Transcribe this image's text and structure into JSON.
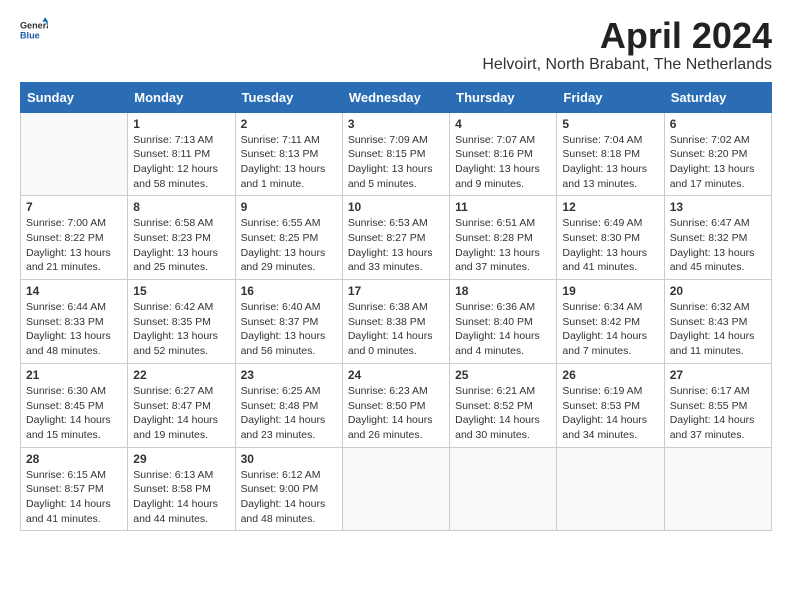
{
  "header": {
    "logo_general": "General",
    "logo_blue": "Blue",
    "month_title": "April 2024",
    "location": "Helvoirt, North Brabant, The Netherlands"
  },
  "days_of_week": [
    "Sunday",
    "Monday",
    "Tuesday",
    "Wednesday",
    "Thursday",
    "Friday",
    "Saturday"
  ],
  "weeks": [
    [
      {
        "day": "",
        "sunrise": "",
        "sunset": "",
        "daylight": ""
      },
      {
        "day": "1",
        "sunrise": "Sunrise: 7:13 AM",
        "sunset": "Sunset: 8:11 PM",
        "daylight": "Daylight: 12 hours and 58 minutes."
      },
      {
        "day": "2",
        "sunrise": "Sunrise: 7:11 AM",
        "sunset": "Sunset: 8:13 PM",
        "daylight": "Daylight: 13 hours and 1 minute."
      },
      {
        "day": "3",
        "sunrise": "Sunrise: 7:09 AM",
        "sunset": "Sunset: 8:15 PM",
        "daylight": "Daylight: 13 hours and 5 minutes."
      },
      {
        "day": "4",
        "sunrise": "Sunrise: 7:07 AM",
        "sunset": "Sunset: 8:16 PM",
        "daylight": "Daylight: 13 hours and 9 minutes."
      },
      {
        "day": "5",
        "sunrise": "Sunrise: 7:04 AM",
        "sunset": "Sunset: 8:18 PM",
        "daylight": "Daylight: 13 hours and 13 minutes."
      },
      {
        "day": "6",
        "sunrise": "Sunrise: 7:02 AM",
        "sunset": "Sunset: 8:20 PM",
        "daylight": "Daylight: 13 hours and 17 minutes."
      }
    ],
    [
      {
        "day": "7",
        "sunrise": "Sunrise: 7:00 AM",
        "sunset": "Sunset: 8:22 PM",
        "daylight": "Daylight: 13 hours and 21 minutes."
      },
      {
        "day": "8",
        "sunrise": "Sunrise: 6:58 AM",
        "sunset": "Sunset: 8:23 PM",
        "daylight": "Daylight: 13 hours and 25 minutes."
      },
      {
        "day": "9",
        "sunrise": "Sunrise: 6:55 AM",
        "sunset": "Sunset: 8:25 PM",
        "daylight": "Daylight: 13 hours and 29 minutes."
      },
      {
        "day": "10",
        "sunrise": "Sunrise: 6:53 AM",
        "sunset": "Sunset: 8:27 PM",
        "daylight": "Daylight: 13 hours and 33 minutes."
      },
      {
        "day": "11",
        "sunrise": "Sunrise: 6:51 AM",
        "sunset": "Sunset: 8:28 PM",
        "daylight": "Daylight: 13 hours and 37 minutes."
      },
      {
        "day": "12",
        "sunrise": "Sunrise: 6:49 AM",
        "sunset": "Sunset: 8:30 PM",
        "daylight": "Daylight: 13 hours and 41 minutes."
      },
      {
        "day": "13",
        "sunrise": "Sunrise: 6:47 AM",
        "sunset": "Sunset: 8:32 PM",
        "daylight": "Daylight: 13 hours and 45 minutes."
      }
    ],
    [
      {
        "day": "14",
        "sunrise": "Sunrise: 6:44 AM",
        "sunset": "Sunset: 8:33 PM",
        "daylight": "Daylight: 13 hours and 48 minutes."
      },
      {
        "day": "15",
        "sunrise": "Sunrise: 6:42 AM",
        "sunset": "Sunset: 8:35 PM",
        "daylight": "Daylight: 13 hours and 52 minutes."
      },
      {
        "day": "16",
        "sunrise": "Sunrise: 6:40 AM",
        "sunset": "Sunset: 8:37 PM",
        "daylight": "Daylight: 13 hours and 56 minutes."
      },
      {
        "day": "17",
        "sunrise": "Sunrise: 6:38 AM",
        "sunset": "Sunset: 8:38 PM",
        "daylight": "Daylight: 14 hours and 0 minutes."
      },
      {
        "day": "18",
        "sunrise": "Sunrise: 6:36 AM",
        "sunset": "Sunset: 8:40 PM",
        "daylight": "Daylight: 14 hours and 4 minutes."
      },
      {
        "day": "19",
        "sunrise": "Sunrise: 6:34 AM",
        "sunset": "Sunset: 8:42 PM",
        "daylight": "Daylight: 14 hours and 7 minutes."
      },
      {
        "day": "20",
        "sunrise": "Sunrise: 6:32 AM",
        "sunset": "Sunset: 8:43 PM",
        "daylight": "Daylight: 14 hours and 11 minutes."
      }
    ],
    [
      {
        "day": "21",
        "sunrise": "Sunrise: 6:30 AM",
        "sunset": "Sunset: 8:45 PM",
        "daylight": "Daylight: 14 hours and 15 minutes."
      },
      {
        "day": "22",
        "sunrise": "Sunrise: 6:27 AM",
        "sunset": "Sunset: 8:47 PM",
        "daylight": "Daylight: 14 hours and 19 minutes."
      },
      {
        "day": "23",
        "sunrise": "Sunrise: 6:25 AM",
        "sunset": "Sunset: 8:48 PM",
        "daylight": "Daylight: 14 hours and 23 minutes."
      },
      {
        "day": "24",
        "sunrise": "Sunrise: 6:23 AM",
        "sunset": "Sunset: 8:50 PM",
        "daylight": "Daylight: 14 hours and 26 minutes."
      },
      {
        "day": "25",
        "sunrise": "Sunrise: 6:21 AM",
        "sunset": "Sunset: 8:52 PM",
        "daylight": "Daylight: 14 hours and 30 minutes."
      },
      {
        "day": "26",
        "sunrise": "Sunrise: 6:19 AM",
        "sunset": "Sunset: 8:53 PM",
        "daylight": "Daylight: 14 hours and 34 minutes."
      },
      {
        "day": "27",
        "sunrise": "Sunrise: 6:17 AM",
        "sunset": "Sunset: 8:55 PM",
        "daylight": "Daylight: 14 hours and 37 minutes."
      }
    ],
    [
      {
        "day": "28",
        "sunrise": "Sunrise: 6:15 AM",
        "sunset": "Sunset: 8:57 PM",
        "daylight": "Daylight: 14 hours and 41 minutes."
      },
      {
        "day": "29",
        "sunrise": "Sunrise: 6:13 AM",
        "sunset": "Sunset: 8:58 PM",
        "daylight": "Daylight: 14 hours and 44 minutes."
      },
      {
        "day": "30",
        "sunrise": "Sunrise: 6:12 AM",
        "sunset": "Sunset: 9:00 PM",
        "daylight": "Daylight: 14 hours and 48 minutes."
      },
      {
        "day": "",
        "sunrise": "",
        "sunset": "",
        "daylight": ""
      },
      {
        "day": "",
        "sunrise": "",
        "sunset": "",
        "daylight": ""
      },
      {
        "day": "",
        "sunrise": "",
        "sunset": "",
        "daylight": ""
      },
      {
        "day": "",
        "sunrise": "",
        "sunset": "",
        "daylight": ""
      }
    ]
  ]
}
